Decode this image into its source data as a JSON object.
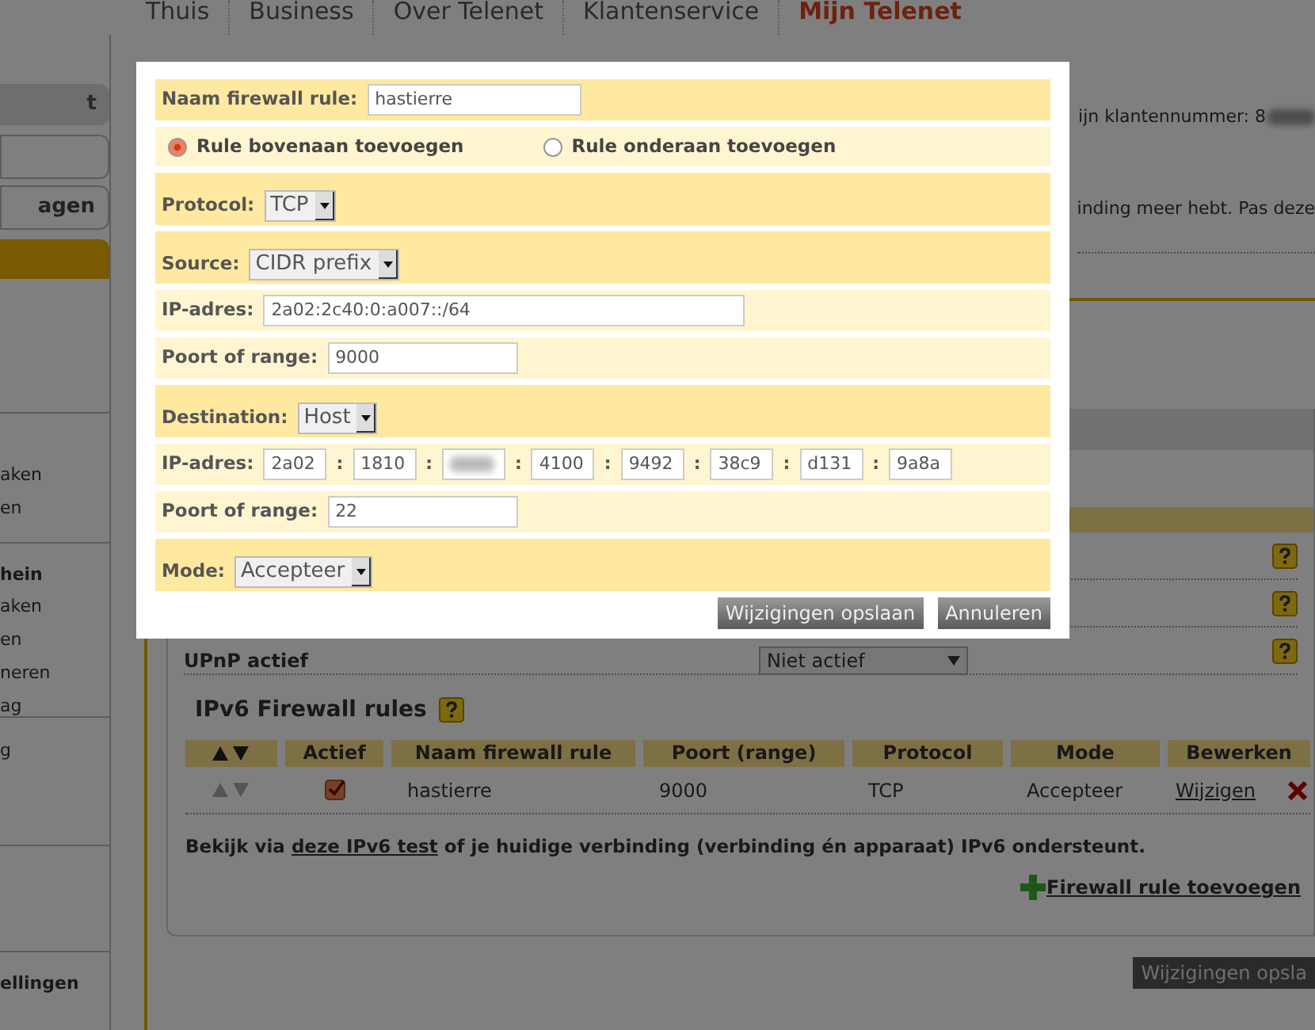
{
  "nav": [
    {
      "label": "Thuis",
      "selected": false
    },
    {
      "label": "Business",
      "selected": false
    },
    {
      "label": "Over Telenet",
      "selected": false
    },
    {
      "label": "Klantenservice",
      "selected": false
    },
    {
      "label": "Mijn Telenet",
      "selected": true
    }
  ],
  "sidebar": {
    "buttons": [
      {
        "kind": "filled",
        "label": "t"
      },
      {
        "kind": "outline"
      },
      {
        "kind": "outline",
        "label": "agen"
      },
      {
        "kind": "active"
      }
    ],
    "groups": [
      {
        "items": [
          "aken",
          "en"
        ]
      },
      {
        "heading": "hein",
        "items": [
          "aken",
          "en",
          "neren",
          "ag"
        ]
      },
      {
        "items": [
          "g"
        ]
      },
      {
        "heading": "ellingen"
      }
    ]
  },
  "customer_number": "ijn klantennummer: 8",
  "notice": "inding meer hebt. Pas deze",
  "settings_rows": [
    {
      "kind": "help_only"
    },
    {
      "kind": "help_only"
    },
    {
      "kind": "select",
      "label": "UPnP actief",
      "select": "Niet actief"
    }
  ],
  "ipv6": {
    "title": "IPv6 Firewall rules",
    "columns": [
      "Actief",
      "Naam firewall rule",
      "Poort (range)",
      "Protocol",
      "Mode",
      "Bewerken"
    ],
    "rows": [
      {
        "active": true,
        "name": "hastierre",
        "port": "9000",
        "protocol": "TCP",
        "mode": "Accepteer",
        "edit": "Wijzigen"
      }
    ],
    "note": {
      "before": "Bekijk via",
      "link": "deze IPv6 test",
      "after": "of je huidige verbinding (verbinding én apparaat) IPv6 ondersteunt."
    },
    "add_link": "Firewall rule toevoegen"
  },
  "save_button": "Wijzigingen opsla",
  "dialog": {
    "rows": [
      {
        "kind": "name",
        "label": "Naam firewall rule:",
        "value": "hastierre"
      },
      {
        "kind": "radios",
        "options": [
          {
            "label": "Rule bovenaan toevoegen",
            "selected": true
          },
          {
            "label": "Rule onderaan toevoegen",
            "selected": false
          }
        ]
      },
      {
        "kind": "select",
        "label": "Protocol:",
        "value": "TCP"
      },
      {
        "kind": "select",
        "label": "Source:",
        "value": "CIDR prefix"
      },
      {
        "kind": "address",
        "label": "IP-adres:",
        "value": "2a02:2c40:0:a007::/64"
      },
      {
        "kind": "port",
        "label": "Poort of range:",
        "value": "9000"
      },
      {
        "kind": "select",
        "label": "Destination:",
        "value": "Host"
      },
      {
        "kind": "ip",
        "label": "IP-adres:",
        "groups": [
          {
            "value": "2a02",
            "blurred": false
          },
          {
            "sep": ":",
            "value": "1810",
            "blurred": false
          },
          {
            "sep": ":",
            "blurred": true
          },
          {
            "sep": ":",
            "value": "4100",
            "blurred": false
          },
          {
            "sep": ":",
            "value": "9492",
            "blurred": false
          },
          {
            "sep": ":",
            "value": "38c9",
            "blurred": false
          },
          {
            "sep": ":",
            "value": "d131",
            "blurred": false
          },
          {
            "sep": ":",
            "value": "9a8a",
            "blurred": false
          }
        ]
      },
      {
        "kind": "port",
        "label": "Poort of range:",
        "value": "22"
      },
      {
        "kind": "select",
        "label": "Mode:",
        "value": "Accepteer"
      }
    ],
    "buttons": [
      "Wijzigingen opslaan",
      "Annuleren"
    ]
  }
}
